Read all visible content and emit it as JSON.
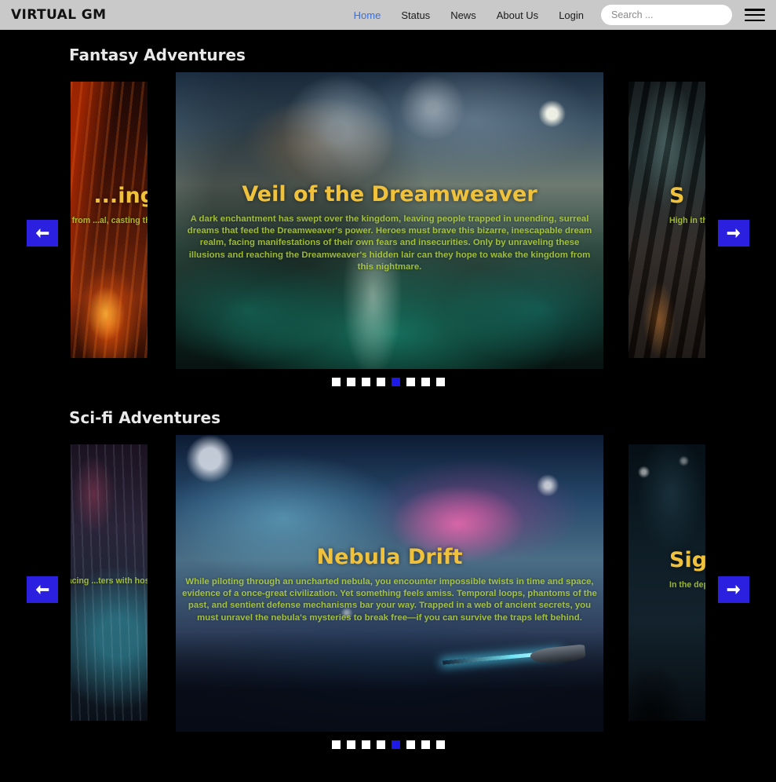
{
  "header": {
    "brand": "VIRTUAL GM",
    "nav": [
      {
        "label": "Home",
        "active": true
      },
      {
        "label": "Status",
        "active": false
      },
      {
        "label": "News",
        "active": false
      },
      {
        "label": "About Us",
        "active": false
      },
      {
        "label": "Login",
        "active": false
      }
    ],
    "search_placeholder": "Search ...",
    "search_value": "",
    "menu_icon": "hamburger-icon",
    "background_color": "#c9c9c9",
    "active_link_color": "#3a6fd8"
  },
  "sections": [
    {
      "title": "Fantasy Adventures",
      "prev_label": "Previous",
      "next_label": "Next",
      "left_card": {
        "title": "...ing",
        "description": "...ne and rises from ...al, casting the ...him. Will they ...eternal fire?"
      },
      "main_card": {
        "title": "Veil of the Dreamweaver",
        "description": "A dark enchantment has swept over the kingdom, leaving people trapped in unending, surreal dreams that feed the Dreamweaver's power. Heroes must brave this bizarre, inescapable dream realm, facing manifestations of their own fears and insecurities. Only by unraveling these illusions and reaching the Dreamweaver's hidden lair can they hope to wake the kingdom from this nightmare."
      },
      "right_card": {
        "title": "S",
        "description": "High in the myst... fallen into dan... shroud the wo..."
      },
      "dots": {
        "count": 8,
        "active_index": 4
      }
    },
    {
      "title": "Sci-fi Adventures",
      "prev_label": "Previous",
      "next_label": "Next",
      "left_card": {
        "title": "",
        "description": "...sked with tracing ...ters with hostile ...manity's future, ...a revelation tha..."
      },
      "main_card": {
        "title": "Nebula Drift",
        "description": "While piloting through an uncharted nebula, you encounter impossible twists in time and space, evidence of a once-great civilization. Yet something feels amiss. Temporal loops, phantoms of the past, and sentient defense mechanisms bar your way. Trapped in a web of ancient secrets, you must unravel the nebula's mysteries to break free—if you can survive the traps left behind."
      },
      "right_card": {
        "title": "Sig",
        "description": "In the depths of ... ways that defy l..."
      },
      "dots": {
        "count": 8,
        "active_index": 4
      }
    }
  ],
  "theme": {
    "page_background": "#000000",
    "title_color": "#f0c23c",
    "description_color": "#cef03e",
    "arrow_button_color": "#2b1fe0",
    "dot_active_color": "#1d1ae8",
    "dot_color": "#ffffff",
    "section_title_color": "#e9e9e9"
  }
}
